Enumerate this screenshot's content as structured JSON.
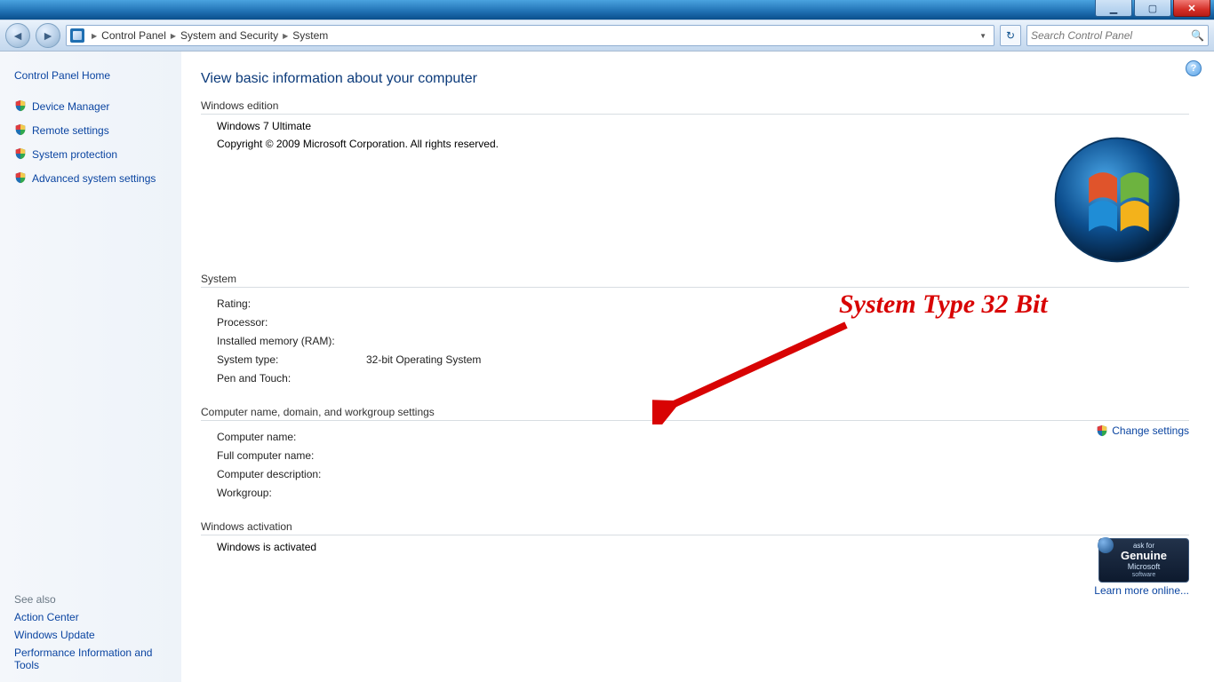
{
  "breadcrumb": {
    "b1": "Control Panel",
    "b2": "System and Security",
    "b3": "System"
  },
  "search": {
    "placeholder": "Search Control Panel"
  },
  "sidebar": {
    "home": "Control Panel Home",
    "links": [
      "Device Manager",
      "Remote settings",
      "System protection",
      "Advanced system settings"
    ],
    "seealso_hdr": "See also",
    "seealso": [
      "Action Center",
      "Windows Update",
      "Performance Information and Tools"
    ]
  },
  "page_title": "View basic information about your computer",
  "winedition": {
    "hdr": "Windows edition",
    "name": "Windows 7 Ultimate",
    "copyright": "Copyright © 2009 Microsoft Corporation.  All rights reserved."
  },
  "system": {
    "hdr": "System",
    "rating_lbl": "Rating:",
    "rating_val": "",
    "proc_lbl": "Processor:",
    "proc_val": "",
    "mem_lbl": "Installed memory (RAM):",
    "mem_val": "",
    "type_lbl": "System type:",
    "type_val": "32-bit Operating System",
    "pen_lbl": "Pen and Touch:",
    "pen_val": ""
  },
  "compname": {
    "hdr": "Computer name, domain, and workgroup settings",
    "cn_lbl": "Computer name:",
    "cn_val": "",
    "fcn_lbl": "Full computer name:",
    "fcn_val": "",
    "desc_lbl": "Computer description:",
    "desc_val": "",
    "wg_lbl": "Workgroup:",
    "wg_val": "",
    "change": "Change settings"
  },
  "activation": {
    "hdr": "Windows activation",
    "status": "Windows is activated",
    "learn": "Learn more online...",
    "genuine_ask": "ask for",
    "genuine_big": "Genuine",
    "genuine_ms": "Microsoft",
    "genuine_sw": "software"
  },
  "annotation": "System Type 32 Bit"
}
